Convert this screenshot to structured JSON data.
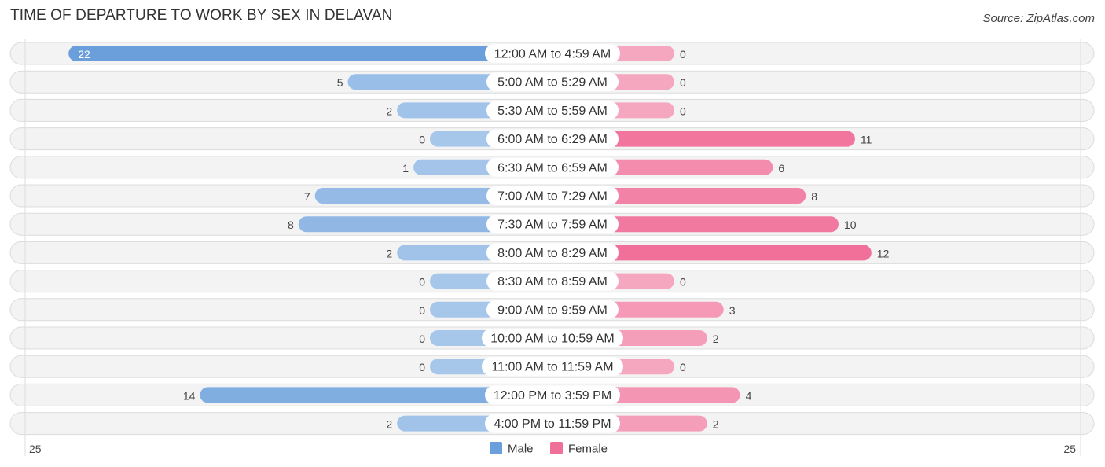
{
  "header": {
    "title": "TIME OF DEPARTURE TO WORK BY SEX IN DELAVAN",
    "source": "Source: ZipAtlas.com"
  },
  "colors": {
    "male_strong": "#6a9fdb",
    "male_light": "#a7c7ea",
    "female_strong": "#f07099",
    "female_light": "#f6a7c0"
  },
  "chart_data": {
    "type": "bar",
    "orientation": "horizontal-diverging",
    "title": "TIME OF DEPARTURE TO WORK BY SEX IN DELAVAN",
    "categories": [
      "12:00 AM to 4:59 AM",
      "5:00 AM to 5:29 AM",
      "5:30 AM to 5:59 AM",
      "6:00 AM to 6:29 AM",
      "6:30 AM to 6:59 AM",
      "7:00 AM to 7:29 AM",
      "7:30 AM to 7:59 AM",
      "8:00 AM to 8:29 AM",
      "8:30 AM to 8:59 AM",
      "9:00 AM to 9:59 AM",
      "10:00 AM to 10:59 AM",
      "11:00 AM to 11:59 AM",
      "12:00 PM to 3:59 PM",
      "4:00 PM to 11:59 PM"
    ],
    "series": [
      {
        "name": "Male",
        "values": [
          22,
          5,
          2,
          0,
          1,
          7,
          8,
          2,
          0,
          0,
          0,
          0,
          14,
          2
        ]
      },
      {
        "name": "Female",
        "values": [
          0,
          0,
          0,
          11,
          6,
          8,
          10,
          12,
          0,
          3,
          2,
          0,
          4,
          2
        ]
      }
    ],
    "axis": {
      "left_label": "25",
      "right_label": "25",
      "max": 25
    },
    "legend": {
      "position": "bottom-center",
      "items": [
        "Male",
        "Female"
      ]
    }
  }
}
